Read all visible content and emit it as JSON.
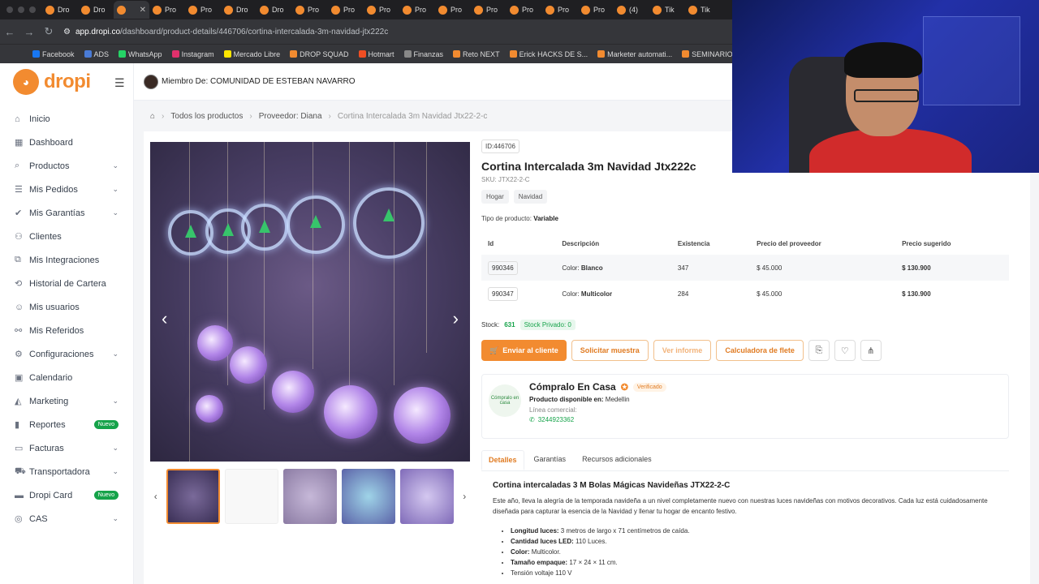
{
  "browser": {
    "tabs": [
      {
        "label": "Dro"
      },
      {
        "label": "Dro"
      },
      {
        "label": "",
        "active": true
      },
      {
        "label": "Pro"
      },
      {
        "label": "Pro"
      },
      {
        "label": "Dro"
      },
      {
        "label": "Dro"
      },
      {
        "label": "Pro"
      },
      {
        "label": "Pro"
      },
      {
        "label": "Pro"
      },
      {
        "label": "Pro"
      },
      {
        "label": "Pro"
      },
      {
        "label": "Pro"
      },
      {
        "label": "Pro"
      },
      {
        "label": "Pro"
      },
      {
        "label": "Pro"
      },
      {
        "label": "(4)"
      },
      {
        "label": "Tik"
      },
      {
        "label": "Tik"
      }
    ],
    "url_host": "app.dropi.co",
    "url_path": "/dashboard/product-details/446706/cortina-intercalada-3m-navidad-jtx222c",
    "bookmarks": [
      {
        "label": "Facebook",
        "color": "#1877f2"
      },
      {
        "label": "ADS",
        "color": "#4a7bd6"
      },
      {
        "label": "WhatsApp",
        "color": "#25d366"
      },
      {
        "label": "Instagram",
        "color": "#e1306c"
      },
      {
        "label": "Mercado Libre",
        "color": "#ffe600"
      },
      {
        "label": "DROP SQUAD",
        "color": "#f28b30"
      },
      {
        "label": "Hotmart",
        "color": "#f04e23"
      },
      {
        "label": "Finanzas",
        "color": "#888888"
      },
      {
        "label": "Reto NEXT",
        "color": "#f28b30"
      },
      {
        "label": "Erick HACKS DE S...",
        "color": "#f28b30"
      },
      {
        "label": "Marketer automati...",
        "color": "#f28b30"
      },
      {
        "label": "SEMINARIOS C",
        "color": "#f28b30"
      }
    ]
  },
  "brand": {
    "name": "dropi",
    "accent": "#f28b30"
  },
  "topbar": {
    "member": "Miembro De: COMUNIDAD DE ESTEBAN NAVARRO"
  },
  "sidebar": {
    "items": [
      {
        "label": "Inicio",
        "icon": "home-icon"
      },
      {
        "label": "Dashboard",
        "icon": "dashboard-icon"
      },
      {
        "label": "Productos",
        "icon": "search-icon",
        "chevron": true
      },
      {
        "label": "Mis Pedidos",
        "icon": "list-icon",
        "chevron": true
      },
      {
        "label": "Mis Garantías",
        "icon": "check-circle-icon",
        "chevron": true
      },
      {
        "label": "Clientes",
        "icon": "users-icon"
      },
      {
        "label": "Mis Integraciones",
        "icon": "integration-icon"
      },
      {
        "label": "Historial de Cartera",
        "icon": "history-icon"
      },
      {
        "label": "Mis usuarios",
        "icon": "user-icon"
      },
      {
        "label": "Mis Referidos",
        "icon": "referral-icon"
      },
      {
        "label": "Configuraciones",
        "icon": "gear-icon",
        "chevron": true
      },
      {
        "label": "Calendario",
        "icon": "calendar-icon"
      },
      {
        "label": "Marketing",
        "icon": "megaphone-icon",
        "chevron": true
      },
      {
        "label": "Reportes",
        "icon": "chart-icon",
        "badge": "Nuevo"
      },
      {
        "label": "Facturas",
        "icon": "invoice-icon",
        "chevron": true
      },
      {
        "label": "Transportadora",
        "icon": "truck-icon",
        "chevron": true
      },
      {
        "label": "Dropi Card",
        "icon": "card-icon",
        "badge": "Nuevo"
      },
      {
        "label": "CAS",
        "icon": "cas-icon",
        "chevron": true
      }
    ]
  },
  "breadcrumb": {
    "all_products": "Todos los productos",
    "supplier": "Proveedor: Diana",
    "current": "Cortina Intercalada 3m Navidad Jtx22-2-c"
  },
  "product": {
    "id_chip": "ID:446706",
    "title": "Cortina Intercalada 3m Navidad Jtx222c",
    "sku": "SKU: JTX22-2-C",
    "tags": [
      "Hogar",
      "Navidad"
    ],
    "type_label": "Tipo de producto:",
    "type_value": "Variable",
    "variants_headers": [
      "Id",
      "Descripción",
      "Existencia",
      "Precio del proveedor",
      "Precio sugerido"
    ],
    "variants": [
      {
        "id": "990346",
        "desc_label": "Color:",
        "desc_value": "Blanco",
        "stock": "347",
        "supplier_price": "$ 45.000",
        "suggested_price": "$ 130.900"
      },
      {
        "id": "990347",
        "desc_label": "Color:",
        "desc_value": "Multicolor",
        "stock": "284",
        "supplier_price": "$ 45.000",
        "suggested_price": "$ 130.900"
      }
    ],
    "stock_label": "Stock:",
    "stock_value": "631",
    "private_stock": "Stock Privado: 0",
    "actions": {
      "send": "Enviar al cliente",
      "request_sample": "Solicitar muestra",
      "view_report": "Ver informe",
      "freight_calc": "Calculadora de flete"
    }
  },
  "supplier": {
    "name": "Cómpralo En Casa",
    "logo_text": "Cómpralo en casa",
    "verified": "Verificado",
    "available_label": "Producto disponible en:",
    "available_value": "Medellin",
    "commercial_line_label": "Línea comercial:",
    "phone": "3244923362"
  },
  "detail_tabs": [
    "Detalles",
    "Garantías",
    "Recursos adicionales"
  ],
  "description": {
    "heading": "Cortina intercaladas 3 M Bolas Mágicas Navideñas JTX22-2-C",
    "intro": "Este año, lleva la alegría de la temporada navideña a un nivel completamente nuevo con nuestras luces navideñas con motivos decorativos. Cada luz está cuidadosamente diseñada para capturar la esencia de la Navidad y llenar tu hogar de encanto festivo.",
    "bullets": [
      {
        "label": "Longitud luces:",
        "value": "3 metros de largo x 71 centímetros de caída."
      },
      {
        "label": "Cantidad luces LED:",
        "value": "110 Luces."
      },
      {
        "label": "Color:",
        "value": "Multicolor."
      },
      {
        "label": "Tamaño empaque:",
        "value": "17 × 24 × 11 cm."
      },
      {
        "label": "",
        "value": "Tensión voltaje 110 V"
      }
    ]
  }
}
